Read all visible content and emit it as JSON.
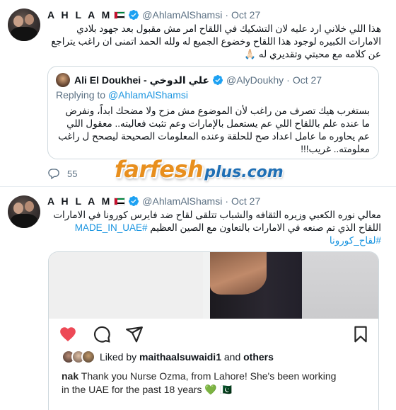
{
  "colors": {
    "accent": "#1b95e0",
    "verified": "#1da1f2",
    "secondary_text": "#5b7083",
    "heart": "#ed4956",
    "watermark_orange": "#e88f1e",
    "watermark_blue": "#1f6fb5"
  },
  "tweets": [
    {
      "author": {
        "name": "A H L A M",
        "handle": "@AhlamAlShamsi",
        "avatar_icon": "profile-photo"
      },
      "separator": "·",
      "date": "Oct 27",
      "text_lines": [
        "هذا اللي خلاني ارد عليه لان  التشكيك في اللقاح امر مش مقبول بعد جهود بلادي",
        "الامارات الكبيره لوجود هذا اللقاح وخضوع الجميع له ولله الحمد اتمنى ان راغب يتراجع",
        "عن كلامه مع محبتي وتقديري له 🙏🏻"
      ],
      "quoted": {
        "author": {
          "name": "Ali El Doukhei - علي الدوخي",
          "handle": "@AlyDoukhy"
        },
        "separator": "·",
        "date": "Oct 27",
        "replying_prefix": "Replying to",
        "replying_to": "@AhlamAlShamsi",
        "text_lines": [
          "بستغرب هيك تصرف من راغب لأن الموضوع مش مزح ولا مضحك ابداً، ونفرض",
          "ما عنده علم باللقاح اللي عم يستعمل بالإمارات وعم تثبت فعاليته.. معقول اللي",
          "عم يحاوره ما عامل اعداد صح للحلقة وعنده المعلومات الصحيحة ليصحح ل راغب",
          "معلومته.. غريب!!!"
        ]
      },
      "actions": {
        "reply_icon": "comment-icon",
        "reply_count": "55"
      }
    },
    {
      "author": {
        "name": "A H L A M",
        "handle": "@AhlamAlShamsi",
        "avatar_icon": "profile-photo"
      },
      "separator": "·",
      "date": "Oct 27",
      "text_lines": [
        "معالي نوره الكعبي وزيره الثقافه والشباب تتلقى لقاح ضد فايرس كورونا في الامارات",
        "اللقاح الذي تم صنعه في الامارات بالتعاون مع الصين العظيم"
      ],
      "hashtags": [
        "#MADE_IN_UAE",
        "#لقاح_كورونا"
      ],
      "media": {
        "icons": [
          "heart-icon",
          "comment-icon",
          "share-icon",
          "bookmark-icon"
        ],
        "liked_prefix": "Liked by",
        "liked_user": "maithaalsuwaidi1",
        "liked_and": "and",
        "liked_others": "others",
        "caption_user": "nak",
        "caption_line1": "Thank you Nurse Ozma, from Lahore! She's been working",
        "caption_line2": "in the UAE for the past 18 years 💚 🇵🇰"
      }
    }
  ],
  "watermark": {
    "main": "farfesh",
    "suffix": "plus.com"
  }
}
